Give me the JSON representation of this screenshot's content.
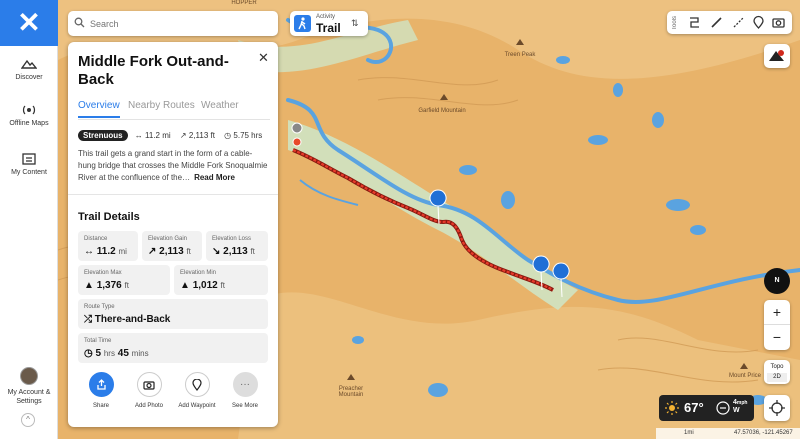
{
  "nav": {
    "items": [
      {
        "label": "Discover",
        "icon": "discover-icon"
      },
      {
        "label": "Offline Maps",
        "icon": "offline-maps-icon"
      },
      {
        "label": "My Content",
        "icon": "my-content-icon"
      }
    ],
    "account_label": "My Account & Settings"
  },
  "search": {
    "placeholder": "Search"
  },
  "activity": {
    "label": "Activity",
    "value": "Trail"
  },
  "panel": {
    "title": "Middle Fork Out-and-Back",
    "tabs": [
      {
        "label": "Overview",
        "active": true
      },
      {
        "label": "Nearby Routes",
        "active": false
      },
      {
        "label": "Weather",
        "active": false
      }
    ],
    "difficulty": "Strenuous",
    "stats": {
      "distance": "11.2 mi",
      "elevation": "2,113 ft",
      "time": "5.75 hrs"
    },
    "description": "This trail gets a grand start in the form of a cable-hung bridge that crosses the Middle Fork Snoqualmie River at the confluence of the…",
    "read_more": "Read More",
    "details_heading": "Trail Details",
    "details": {
      "distance": {
        "label": "Distance",
        "value": "11.2",
        "unit": "mi"
      },
      "elevation_gain": {
        "label": "Elevation Gain",
        "value": "2,113",
        "unit": "ft"
      },
      "elevation_loss": {
        "label": "Elevation Loss",
        "value": "2,113",
        "unit": "ft"
      },
      "elevation_max": {
        "label": "Elevation Max",
        "value": "1,376",
        "unit": "ft"
      },
      "elevation_min": {
        "label": "Elevation Min",
        "value": "1,012",
        "unit": "ft"
      },
      "route_type": {
        "label": "Route Type",
        "value": "There-and-Back"
      },
      "total_time": {
        "label": "Total Time",
        "hours": "5",
        "hrs_unit": "hrs",
        "mins": "45",
        "mins_unit": "mins"
      }
    },
    "actions": [
      {
        "label": "Share",
        "icon": "share-icon"
      },
      {
        "label": "Add Photo",
        "icon": "camera-icon"
      },
      {
        "label": "Add Waypoint",
        "icon": "waypoint-pin-icon"
      },
      {
        "label": "See More",
        "icon": "more-icon"
      }
    ]
  },
  "tools": {
    "label": "Tools"
  },
  "map": {
    "labels": {
      "garfield": "Garfield Mountain",
      "preacher": "Preacher Mountain",
      "mount_price": "Mount Price",
      "top_left": "HOPPER",
      "top_center": "Treen Peak"
    },
    "layer_top": "Topo",
    "layer_bottom": "2D",
    "compass_label": "N",
    "zoom_in": "+",
    "zoom_out": "−"
  },
  "weather": {
    "temp": "67°",
    "wind_speed": "4",
    "wind_unit": "mph",
    "wind_dir": "W"
  },
  "scale": {
    "distance": "1mi",
    "coords": "47.57036, -121.45267"
  },
  "colors": {
    "accent": "#2b7de9",
    "trail": "#d0281c",
    "terrain": "#e8b36a",
    "water": "#5aa3e0"
  }
}
